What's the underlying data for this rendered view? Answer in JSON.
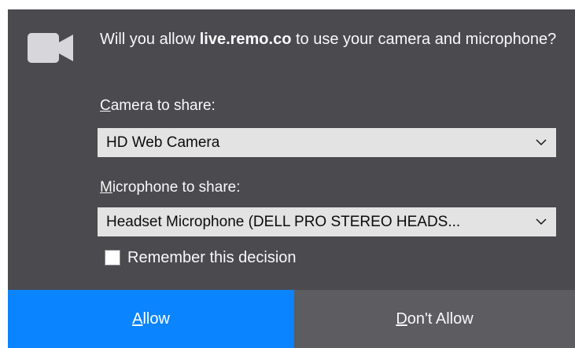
{
  "prompt": {
    "text_before": "Will you allow ",
    "domain": "live.remo.co",
    "text_after": " to use your camera and microphone?"
  },
  "camera": {
    "label_accesskey": "C",
    "label_rest": "amera to share:",
    "selected": "HD Web Camera"
  },
  "microphone": {
    "label_accesskey": "M",
    "label_rest": "icrophone to share:",
    "selected": "Headset Microphone (DELL PRO STEREO HEADS..."
  },
  "remember": {
    "label": "Remember this decision",
    "checked": false
  },
  "buttons": {
    "allow_accesskey": "A",
    "allow_rest": "llow",
    "deny_accesskey": "D",
    "deny_rest": "on't Allow"
  },
  "icons": {
    "camera": "video-camera-icon",
    "dropdown": "chevron-down-icon"
  },
  "colors": {
    "panel_bg": "#4a4a4f",
    "allow_bg": "#0a84ff",
    "deny_bg": "#5c5c61",
    "select_bg": "#e3e3e3"
  }
}
